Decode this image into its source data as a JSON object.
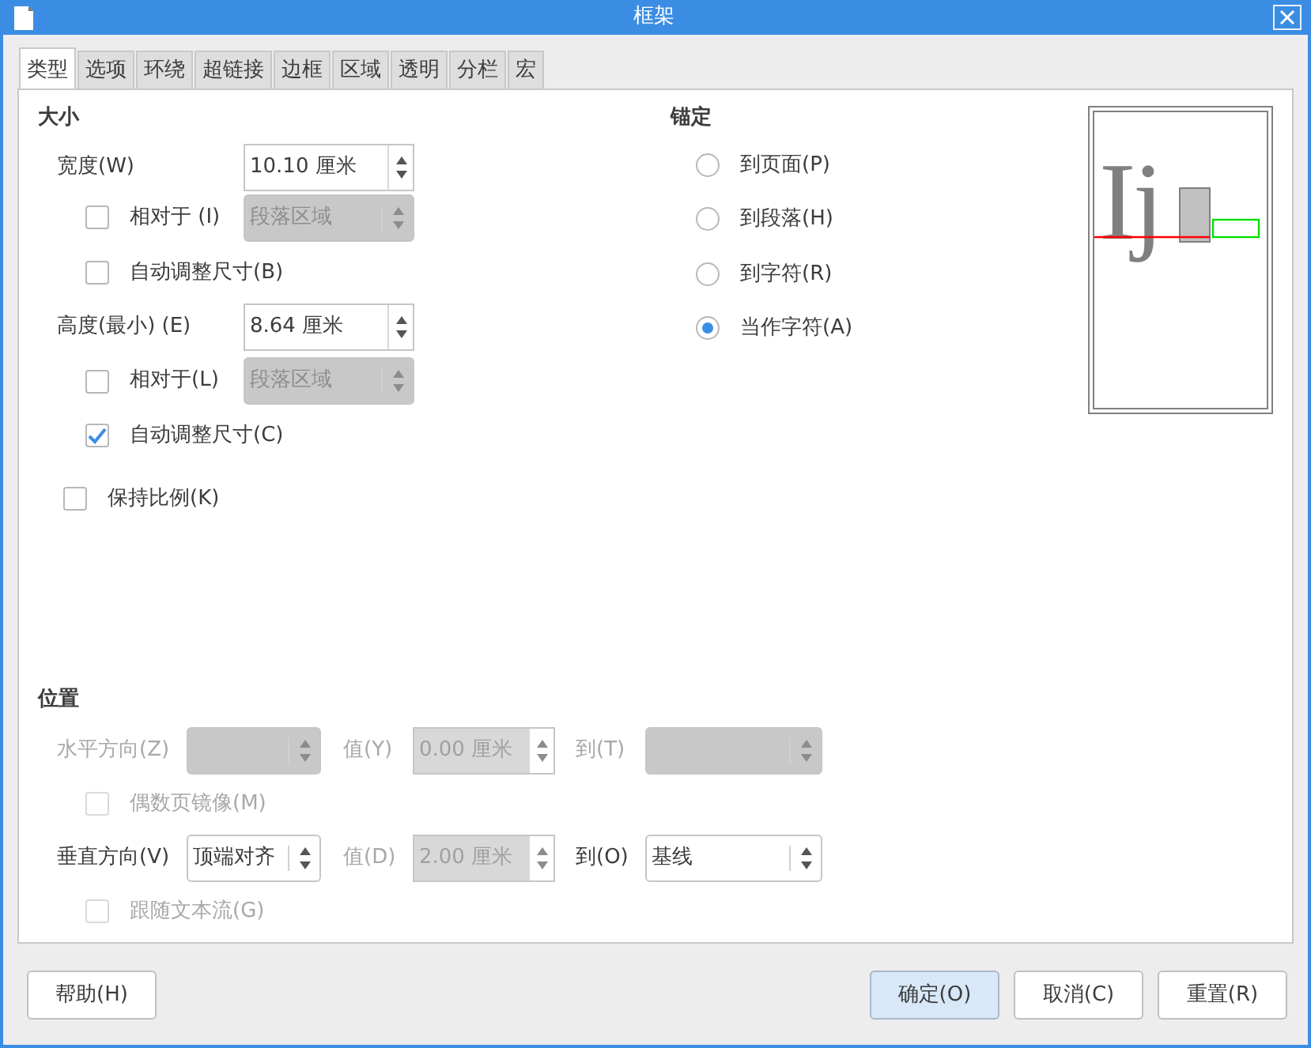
{
  "window": {
    "title": "框架"
  },
  "tabs": [
    {
      "label": "类型",
      "selected": true
    },
    {
      "label": "选项",
      "selected": false
    },
    {
      "label": "环绕",
      "selected": false
    },
    {
      "label": "超链接",
      "selected": false
    },
    {
      "label": "边框",
      "selected": false
    },
    {
      "label": "区域",
      "selected": false
    },
    {
      "label": "透明",
      "selected": false
    },
    {
      "label": "分栏",
      "selected": false
    },
    {
      "label": "宏",
      "selected": false
    }
  ],
  "size": {
    "heading": "大小",
    "width": {
      "label": "宽度(W)",
      "value": "10.10 厘米"
    },
    "width_relative": {
      "label": "相对于 (I)",
      "checked": false,
      "value": "段落区域",
      "disabled": true
    },
    "width_auto": {
      "label": "自动调整尺寸(B)",
      "checked": false
    },
    "height": {
      "label": "高度(最小) (E)",
      "value": "8.64 厘米"
    },
    "height_relative": {
      "label": "相对于(L)",
      "checked": false,
      "value": "段落区域",
      "disabled": true
    },
    "height_auto": {
      "label": "自动调整尺寸(C)",
      "checked": true
    },
    "keep_ratio": {
      "label": "保持比例(K)",
      "checked": false
    }
  },
  "anchor": {
    "heading": "锚定",
    "options": [
      {
        "label": "到页面(P)",
        "selected": false
      },
      {
        "label": "到段落(H)",
        "selected": false
      },
      {
        "label": "到字符(R)",
        "selected": false
      },
      {
        "label": "当作字符(A)",
        "selected": true
      }
    ],
    "preview_sample": "Ij"
  },
  "position": {
    "heading": "位置",
    "horizontal": {
      "label": "水平方向(Z)",
      "disabled": true
    },
    "h_value": {
      "label": "值(Y)",
      "value": "0.00 厘米",
      "disabled": true
    },
    "h_to": {
      "label": "到(T)",
      "disabled": true
    },
    "mirror": {
      "label": "偶数页镜像(M)",
      "checked": false,
      "disabled": true
    },
    "vertical": {
      "label": "垂直方向(V)",
      "value": "顶端对齐",
      "disabled": false
    },
    "v_value": {
      "label": "值(D)",
      "value": "2.00 厘米",
      "disabled": true
    },
    "v_to": {
      "label": "到(O)",
      "value": "基线",
      "disabled": false
    },
    "follow": {
      "label": "跟随文本流(G)",
      "checked": false,
      "disabled": true
    }
  },
  "buttons": [
    {
      "label": "帮助(H)",
      "default": false
    },
    {
      "label": "确定(O)",
      "default": true
    },
    {
      "label": "取消(C)",
      "default": false
    },
    {
      "label": "重置(R)",
      "default": false
    }
  ]
}
